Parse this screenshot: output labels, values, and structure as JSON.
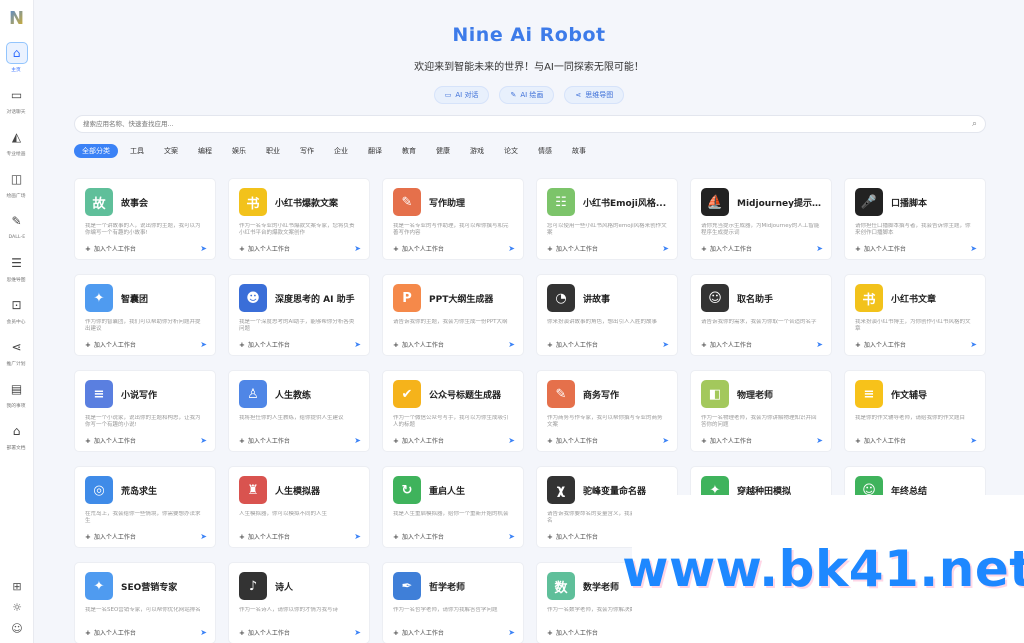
{
  "sidebar": {
    "logo": "N",
    "items": [
      {
        "label": "主页",
        "icon": "home-icon",
        "glyph": "⌂",
        "active": true
      },
      {
        "label": "对话聊天",
        "icon": "chat-icon",
        "glyph": "▭",
        "active": false
      },
      {
        "label": "专业绘画",
        "icon": "paint-icon",
        "glyph": "◭",
        "active": false
      },
      {
        "label": "绘画广场",
        "icon": "gallery-icon",
        "glyph": "◫",
        "active": false
      },
      {
        "label": "DALL-E",
        "icon": "edit-icon",
        "glyph": "✎",
        "active": false
      },
      {
        "label": "思维导图",
        "icon": "mindmap-icon",
        "glyph": "☰",
        "active": false
      },
      {
        "label": "会员中心",
        "icon": "cart-icon",
        "glyph": "⊡",
        "active": false
      },
      {
        "label": "推广计划",
        "icon": "share-icon",
        "glyph": "⋖",
        "active": false
      },
      {
        "label": "我的事项",
        "icon": "notes-icon",
        "glyph": "▤",
        "active": false
      },
      {
        "label": "部署文档",
        "icon": "bank-icon",
        "glyph": "⌂",
        "active": false
      }
    ],
    "bottom": [
      {
        "icon": "gift-icon",
        "glyph": "⊞"
      },
      {
        "icon": "sun-icon",
        "glyph": "☼"
      },
      {
        "icon": "user-icon",
        "glyph": "☺"
      }
    ]
  },
  "header": {
    "title": "Nine Ai Robot",
    "subtitle": "欢迎来到智能未来的世界！与AI一同探索无限可能！",
    "buttons": [
      {
        "label": "AI 对话",
        "icon": "chat-icon",
        "glyph": "▭"
      },
      {
        "label": "AI 绘画",
        "icon": "brush-icon",
        "glyph": "✎"
      },
      {
        "label": "思维导图",
        "icon": "mindmap-icon",
        "glyph": "⋖"
      }
    ]
  },
  "search": {
    "placeholder": "搜索应用名称、快速查找应用..."
  },
  "categories": [
    {
      "label": "全部分类",
      "active": true
    },
    {
      "label": "工具"
    },
    {
      "label": "文案"
    },
    {
      "label": "编程"
    },
    {
      "label": "娱乐"
    },
    {
      "label": "职业"
    },
    {
      "label": "写作"
    },
    {
      "label": "企业"
    },
    {
      "label": "翻译"
    },
    {
      "label": "教育"
    },
    {
      "label": "健康"
    },
    {
      "label": "游戏"
    },
    {
      "label": "论文"
    },
    {
      "label": "情感"
    },
    {
      "label": "故事"
    }
  ],
  "add_label": "加入个人工作台",
  "cards": [
    {
      "title": "故事会",
      "desc": "我是一个讲故事的人，说出你的主题，我可以为你编写一个有趣的小故事!",
      "icon": "book-icon",
      "glyph": "故",
      "color": "#5fbf9a"
    },
    {
      "title": "小红书爆款文案",
      "desc": "作为一名专业的小红书爆款文案专家，您将负责小红书平台的爆款文案创作",
      "icon": "xiaohongshu-icon",
      "glyph": "书",
      "color": "#f2c21b"
    },
    {
      "title": "写作助理",
      "desc": "我是一名专业的写作助理，我可以帮你撰写和完善写作内容",
      "icon": "pen-icon",
      "glyph": "✎",
      "color": "#e5704b"
    },
    {
      "title": "小红书Emoji风格...",
      "desc": "您可以使用一些小红书风格的emoji风格来创作文案",
      "icon": "notebook-icon",
      "glyph": "☷",
      "color": "#7cc46a"
    },
    {
      "title": "Midjourney提示...",
      "desc": "请你充当提示生成器，为Midjourney的人工智能程序生成提示词",
      "icon": "boat-icon",
      "glyph": "⛵",
      "color": "#222222"
    },
    {
      "title": "口播脚本",
      "desc": "请你担任口播脚本撰写者，我会告诉你主题，你来创作口播脚本",
      "icon": "mic-icon",
      "glyph": "🎤",
      "color": "#222222"
    },
    {
      "title": "智囊团",
      "desc": "作为你的智囊团，我们可以帮助你分析问题并提出建议",
      "icon": "bulb-icon",
      "glyph": "✦",
      "color": "#4f9bf0"
    },
    {
      "title": "深度思考的 AI 助手",
      "desc": "我是一个深度思考的AI助手，能够帮你分析各类问题",
      "icon": "robot-icon",
      "glyph": "☻",
      "color": "#3a6ed8"
    },
    {
      "title": "PPT大纲生成器",
      "desc": "请告诉我你的主题，我会为你生成一份PPT大纲",
      "icon": "ppt-icon",
      "glyph": "P",
      "color": "#f5894a"
    },
    {
      "title": "讲故事",
      "desc": "你来扮演讲故事的角色，想出引人入胜的故事",
      "icon": "microphone-icon",
      "glyph": "◔",
      "color": "#333333"
    },
    {
      "title": "取名助手",
      "desc": "请告诉我你的需求，我会为你取一个合适的名字",
      "icon": "idcard-icon",
      "glyph": "☺",
      "color": "#333333"
    },
    {
      "title": "小红书文章",
      "desc": "我来扮演小红书博主，为你创作小红书风格的文章",
      "icon": "xiaohongshu-icon",
      "glyph": "书",
      "color": "#f2c21b"
    },
    {
      "title": "小说写作",
      "desc": "我是一个小说家，说出你的主题和构思，让我为你写一个有趣的小说!",
      "icon": "novel-icon",
      "glyph": "≡",
      "color": "#5a7fe0"
    },
    {
      "title": "人生教练",
      "desc": "我将担任你的人生教练，给你提供人生建议",
      "icon": "coach-icon",
      "glyph": "♙",
      "color": "#4f86e6"
    },
    {
      "title": "公众号标题生成器",
      "desc": "作为一个微信公众号写手，我可以为你生成吸引人的标题",
      "icon": "badge-icon",
      "glyph": "✔",
      "color": "#f5b31b"
    },
    {
      "title": "商务写作",
      "desc": "作为商务写作专家，我可以帮你撰写专业的商务文案",
      "icon": "edit-icon",
      "glyph": "✎",
      "color": "#e5704b"
    },
    {
      "title": "物理老师",
      "desc": "作为一名物理老师，我会为你讲解物理知识并回答你的问题",
      "icon": "shape-icon",
      "glyph": "◧",
      "color": "#a3c85c"
    },
    {
      "title": "作文辅导",
      "desc": "我是你的作文辅导老师，请给我你的作文题目",
      "icon": "note-icon",
      "glyph": "≡",
      "color": "#f7c21a"
    },
    {
      "title": "荒岛求生",
      "desc": "在荒岛上，我会给你一些情境，你需要想办法求生",
      "icon": "lifebuoy-icon",
      "glyph": "◎",
      "color": "#3f8be8"
    },
    {
      "title": "人生模拟器",
      "desc": "人生模拟器，你可以模拟不同的人生",
      "icon": "lighthouse-icon",
      "glyph": "♜",
      "color": "#d9534f"
    },
    {
      "title": "重启人生",
      "desc": "我是人生重启模拟器，给你一个重新开始的机会",
      "icon": "restart-icon",
      "glyph": "↻",
      "color": "#3fb35c"
    },
    {
      "title": "驼峰变量命名器",
      "desc": "请告诉我你要命名的变量含义，我会给你驼峰命名",
      "icon": "variable-icon",
      "glyph": "χ",
      "color": "#333333"
    },
    {
      "title": "穿越种田模拟",
      "desc": "模拟穿越到古代种田的生活",
      "icon": "walk-icon",
      "glyph": "✦",
      "color": "#3fb35c"
    },
    {
      "title": "年终总结",
      "desc": "为你撰写年终总结",
      "icon": "person-icon",
      "glyph": "☺",
      "color": "#3fb35c"
    },
    {
      "title": "SEO营销专家",
      "desc": "我是一名SEO营销专家，可以帮你优化网站排名",
      "icon": "bulb-icon",
      "glyph": "✦",
      "color": "#4f9bf0"
    },
    {
      "title": "诗人",
      "desc": "作为一名诗人，请你以你的才情为我写诗",
      "icon": "poet-icon",
      "glyph": "♪",
      "color": "#333333"
    },
    {
      "title": "哲学老师",
      "desc": "作为一名哲学老师，请你为我解答哲学问题",
      "icon": "feather-icon",
      "glyph": "✒",
      "color": "#3f7fd8"
    },
    {
      "title": "数学老师",
      "desc": "作为一名数学老师，我会为你解决数学问题",
      "icon": "math-icon",
      "glyph": "数",
      "color": "#5fbf9a"
    }
  ],
  "watermark": "www.bk41.net"
}
